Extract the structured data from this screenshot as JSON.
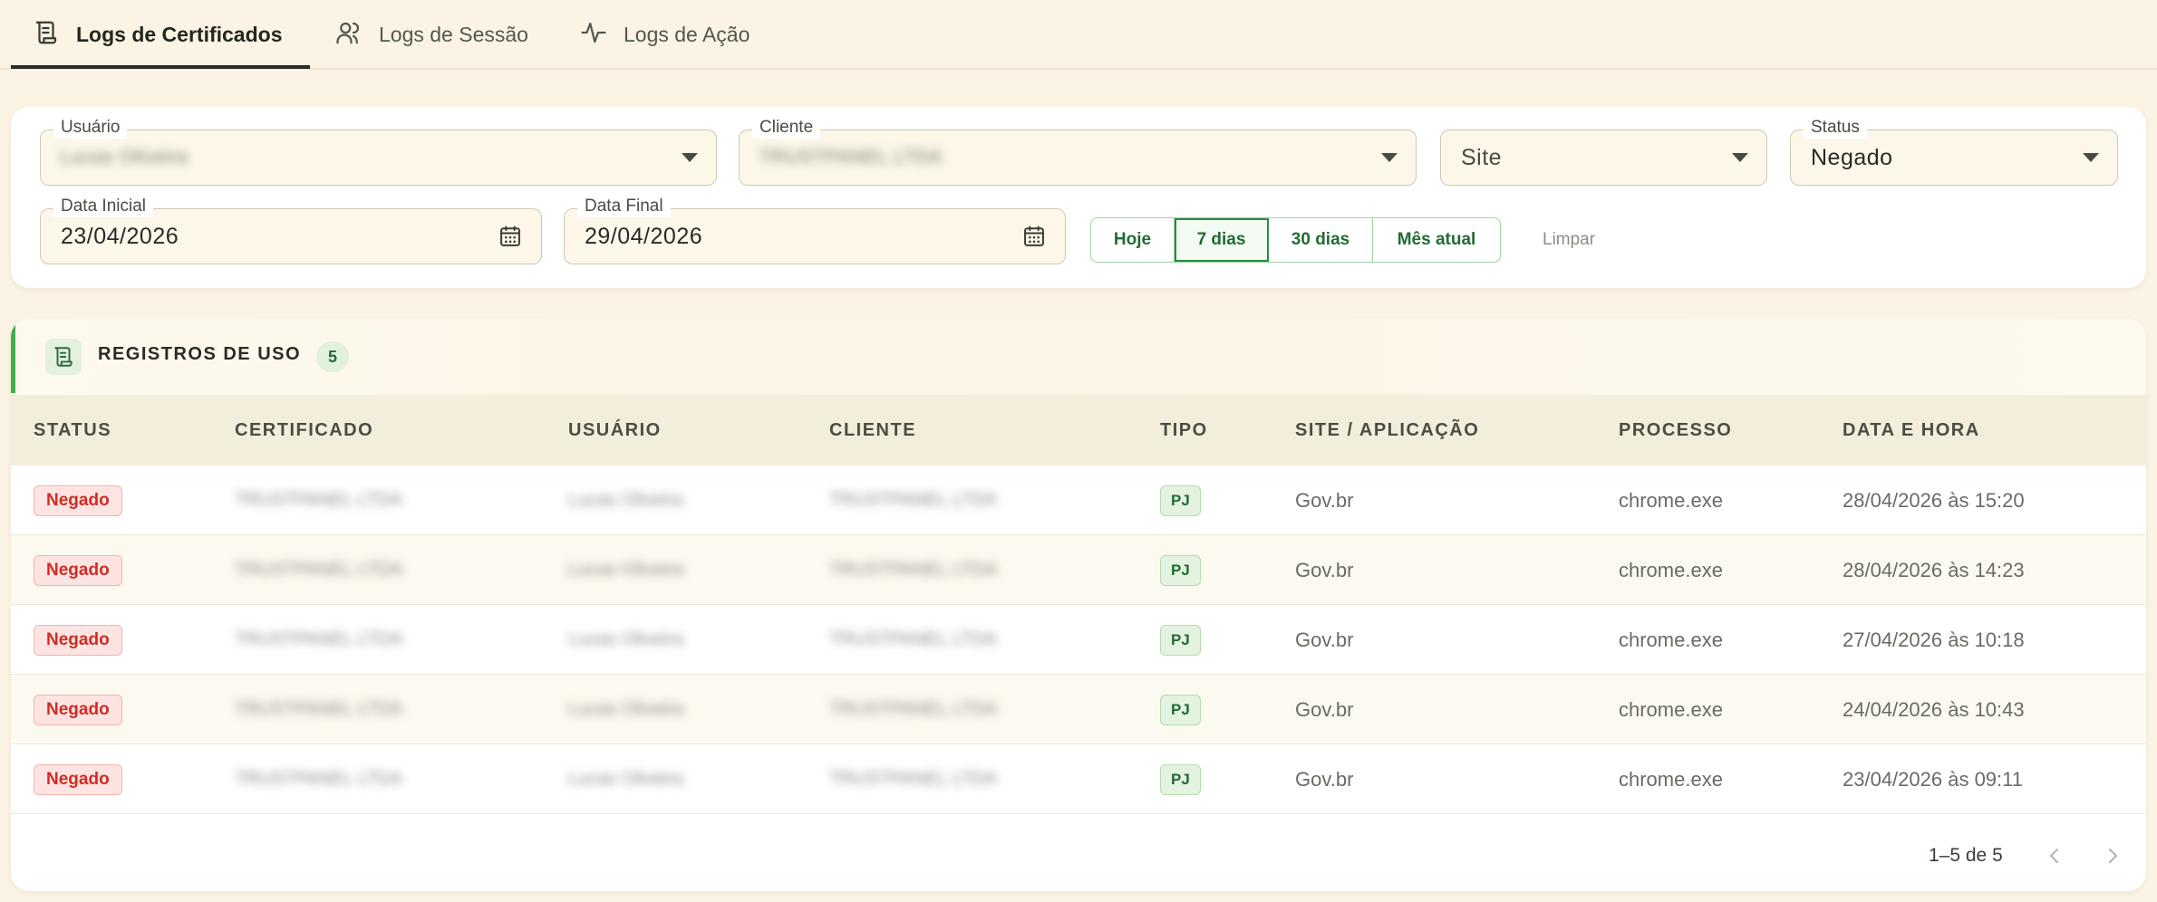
{
  "tabs": [
    {
      "label": "Logs de Certificados",
      "icon": "scroll-icon",
      "active": true
    },
    {
      "label": "Logs de Sessão",
      "icon": "users-icon",
      "active": false
    },
    {
      "label": "Logs de Ação",
      "icon": "activity-icon",
      "active": false
    }
  ],
  "filters": {
    "usuario": {
      "label": "Usuário",
      "value": "Lucas Oliveira"
    },
    "cliente": {
      "label": "Cliente",
      "value": "TRUSTPANEL LTDA"
    },
    "site": {
      "placeholder": "Site"
    },
    "status": {
      "label": "Status",
      "value": "Negado"
    },
    "data_inicial": {
      "label": "Data Inicial",
      "value": "23/04/2026"
    },
    "data_final": {
      "label": "Data Final",
      "value": "29/04/2026"
    },
    "quick_ranges": [
      "Hoje",
      "7 dias",
      "30 dias",
      "Mês atual"
    ],
    "quick_selected": "7 dias",
    "clear_label": "Limpar"
  },
  "table": {
    "title": "REGISTROS DE USO",
    "count": "5",
    "columns": [
      "STATUS",
      "CERTIFICADO",
      "USUÁRIO",
      "CLIENTE",
      "TIPO",
      "SITE / APLICAÇÃO",
      "PROCESSO",
      "DATA E HORA"
    ],
    "rows": [
      {
        "status": "Negado",
        "certificado": "TRUSTPANEL LTDA",
        "usuario": "Lucas Oliveira",
        "cliente": "TRUSTPANEL LTDA",
        "tipo": "PJ",
        "site": "Gov.br",
        "processo": "chrome.exe",
        "data_hora": "28/04/2026 às 15:20"
      },
      {
        "status": "Negado",
        "certificado": "TRUSTPANEL LTDA",
        "usuario": "Lucas Oliveira",
        "cliente": "TRUSTPANEL LTDA",
        "tipo": "PJ",
        "site": "Gov.br",
        "processo": "chrome.exe",
        "data_hora": "28/04/2026 às 14:23"
      },
      {
        "status": "Negado",
        "certificado": "TRUSTPANEL LTDA",
        "usuario": "Lucas Oliveira",
        "cliente": "TRUSTPANEL LTDA",
        "tipo": "PJ",
        "site": "Gov.br",
        "processo": "chrome.exe",
        "data_hora": "27/04/2026 às 10:18"
      },
      {
        "status": "Negado",
        "certificado": "TRUSTPANEL LTDA",
        "usuario": "Lucas Oliveira",
        "cliente": "TRUSTPANEL LTDA",
        "tipo": "PJ",
        "site": "Gov.br",
        "processo": "chrome.exe",
        "data_hora": "24/04/2026 às 10:43"
      },
      {
        "status": "Negado",
        "certificado": "TRUSTPANEL LTDA",
        "usuario": "Lucas Oliveira",
        "cliente": "TRUSTPANEL LTDA",
        "tipo": "PJ",
        "site": "Gov.br",
        "processo": "chrome.exe",
        "data_hora": "23/04/2026 às 09:11"
      }
    ]
  },
  "pagination": {
    "info": "1–5 de 5"
  },
  "colors": {
    "background": "#fbf4e4",
    "accent_green": "#3fae50",
    "status_denied": "#cf2d24"
  }
}
